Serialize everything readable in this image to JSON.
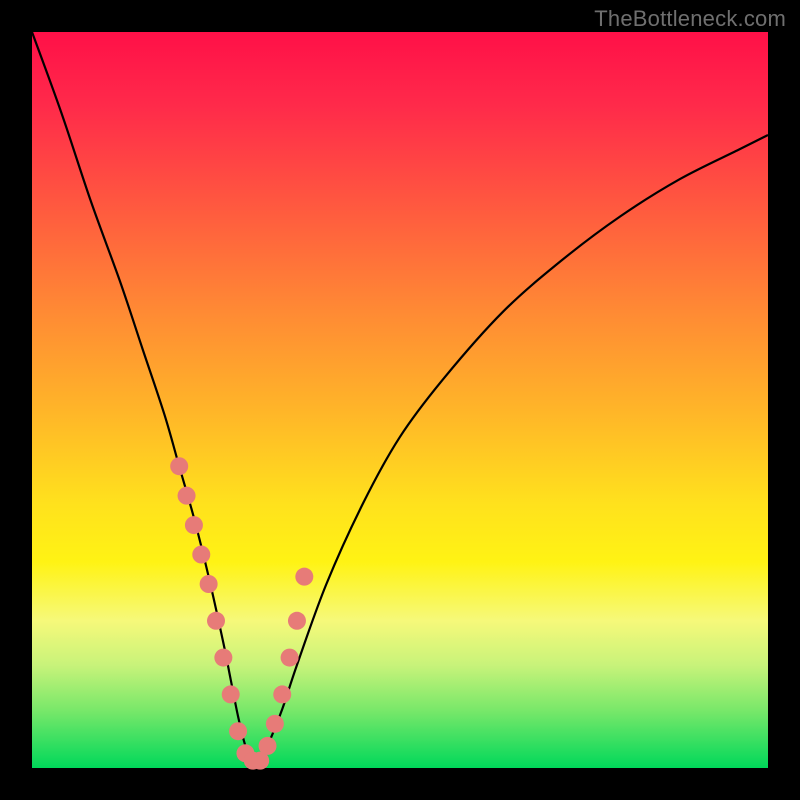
{
  "watermark_text": "TheBottleneck.com",
  "chart_data": {
    "type": "line",
    "title": "",
    "xlabel": "",
    "ylabel": "",
    "xlim": [
      0,
      100
    ],
    "ylim": [
      0,
      100
    ],
    "grid": false,
    "legend": false,
    "series": [
      {
        "name": "bottleneck-curve",
        "x": [
          0,
          4,
          8,
          12,
          15,
          18,
          20,
          22,
          24,
          26,
          27,
          28,
          29,
          30,
          31,
          32,
          34,
          36,
          40,
          45,
          50,
          56,
          64,
          72,
          80,
          88,
          96,
          100
        ],
        "values": [
          100,
          89,
          77,
          66,
          57,
          48,
          41,
          34,
          26,
          17,
          12,
          7,
          3,
          1,
          1,
          3,
          8,
          14,
          25,
          36,
          45,
          53,
          62,
          69,
          75,
          80,
          84,
          86
        ]
      }
    ],
    "annotations": {
      "data_point_markers": {
        "x": [
          20,
          21,
          22,
          23,
          24,
          25,
          26,
          27,
          28,
          29,
          30,
          31,
          32,
          33,
          34,
          35,
          36,
          37
        ],
        "values": [
          41,
          37,
          33,
          29,
          25,
          20,
          15,
          10,
          5,
          2,
          1,
          1,
          3,
          6,
          10,
          15,
          20,
          26
        ]
      }
    }
  },
  "colors": {
    "frame": "#000000",
    "gradient_top": "#ff1048",
    "gradient_mid": "#ffe11d",
    "gradient_bottom": "#00d85a",
    "curve_stroke": "#000000",
    "marker_fill": "#e77b78",
    "watermark": "#6f6f6f"
  }
}
